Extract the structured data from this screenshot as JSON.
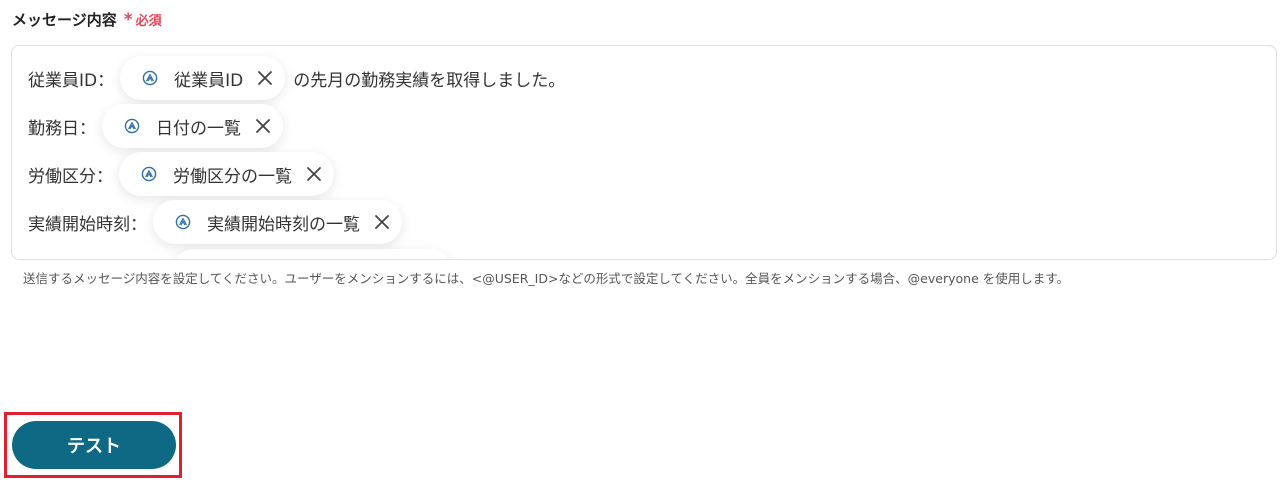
{
  "field": {
    "label": "メッセージ内容",
    "required_mark": "*",
    "required_text": "必須"
  },
  "message": {
    "lines": [
      {
        "prefix": "従業員ID：",
        "chip": "従業員ID",
        "suffix": "の先月の勤務実績を取得しました。"
      },
      {
        "prefix": "勤務日：",
        "chip": "日付の一覧",
        "suffix": ""
      },
      {
        "prefix": "労働区分：",
        "chip": "労働区分の一覧",
        "suffix": ""
      },
      {
        "prefix": "実績開始時刻：",
        "chip": "実績開始時刻の一覧",
        "suffix": ""
      }
    ]
  },
  "hint": "送信するメッセージ内容を設定してください。ユーザーをメンションするには、<@USER_ID>などの形式で設定してください。全員をメンションする場合、@everyone を使用します。",
  "actions": {
    "test_label": "テスト"
  },
  "colors": {
    "accent": "#0e6a84",
    "required": "#e5485b",
    "highlight": "#e0202f",
    "chip_icon": "#2f6fa8"
  },
  "icons": {
    "chip": "app-logo-icon",
    "remove": "close-icon"
  }
}
